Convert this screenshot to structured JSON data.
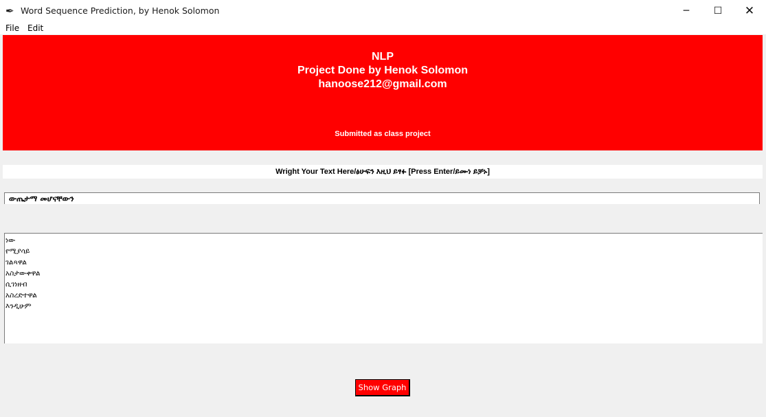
{
  "window": {
    "title": "Word Sequence Prediction, by Henok Solomon",
    "icon": "feather-icon",
    "controls": {
      "minimize": "─",
      "maximize": "☐",
      "close": "✕"
    }
  },
  "menu": {
    "items": [
      "File",
      "Edit"
    ]
  },
  "banner": {
    "title": "NLP",
    "author_line": "Project Done by Henok Solomon",
    "email": "hanoose212@gmail.com",
    "subtitle": "Submitted as class project",
    "background": "#ff0000"
  },
  "prompt": {
    "label": "Wright Your Text Here/ፅሁፍን እዚህ ይፃፉ [Press Enter/ይሙነ ይቻኑ]"
  },
  "input": {
    "value": "ውጤታማ መሆናቸውን"
  },
  "suggestions": [
    "ነው",
    "የሚያሳይ",
    "ገልጻዋል",
    "አስታውቀዋል",
    "ሲገነዘብ",
    "አስረድተዋል",
    "እንዲሁም"
  ],
  "graph_button": {
    "label": "Show Graph",
    "background": "#ff0000"
  }
}
